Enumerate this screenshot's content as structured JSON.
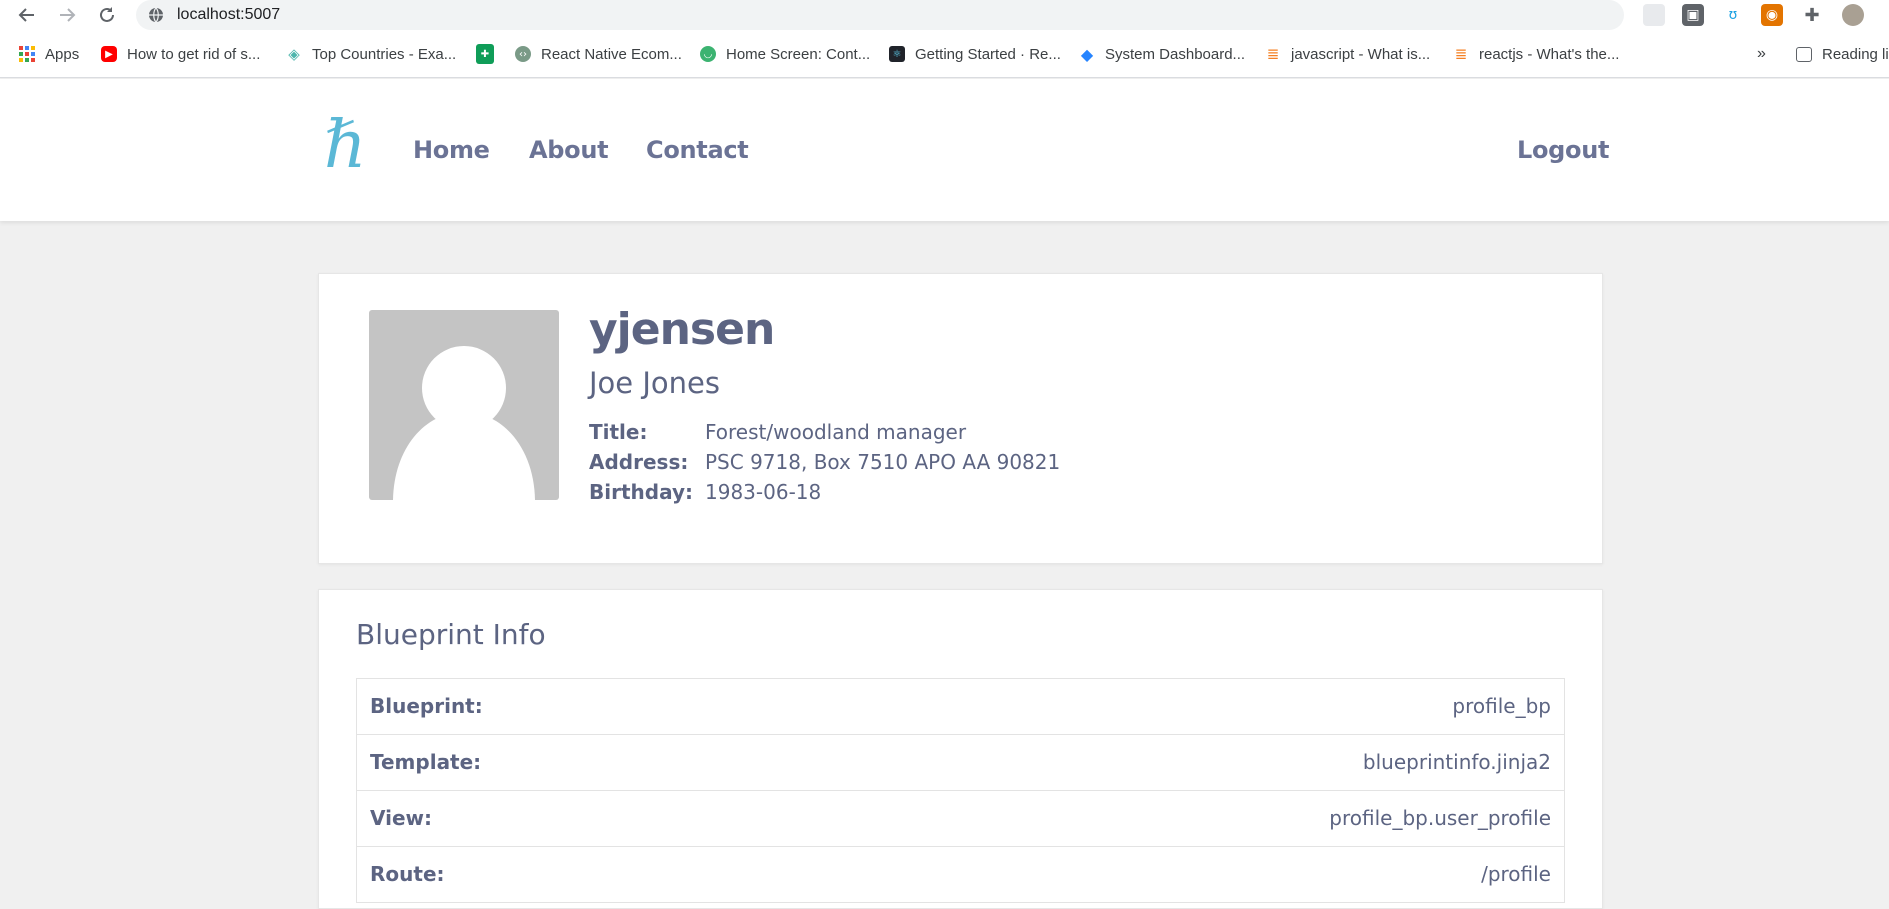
{
  "browser": {
    "url": "localhost:5007",
    "bookmarks": [
      {
        "label": "Apps",
        "icon": "apps-grid-icon"
      },
      {
        "label": "How to get rid of s...",
        "icon": "youtube-icon"
      },
      {
        "label": "Top Countries - Exa...",
        "icon": "layers-icon"
      },
      {
        "label": "",
        "icon": "sheets-icon"
      },
      {
        "label": "React Native Ecom...",
        "icon": "code-hex-icon"
      },
      {
        "label": "Home Screen: Cont...",
        "icon": "smile-icon"
      },
      {
        "label": "Getting Started · Re...",
        "icon": "react-icon"
      },
      {
        "label": "System Dashboard...",
        "icon": "jira-icon"
      },
      {
        "label": "javascript - What is...",
        "icon": "stackoverflow-icon"
      },
      {
        "label": "reactjs - What's the...",
        "icon": "stackoverflow-icon"
      }
    ],
    "more": "»",
    "reading_list": "Reading li"
  },
  "header": {
    "logo_glyph": "ℏ",
    "nav": [
      "Home",
      "About",
      "Contact"
    ],
    "logout": "Logout"
  },
  "profile": {
    "username": "yjensen",
    "name": "Joe Jones",
    "details": [
      {
        "label": "Title:",
        "value": "Forest/woodland manager"
      },
      {
        "label": "Address:",
        "value": "PSC 9718, Box 7510 APO AA 90821"
      },
      {
        "label": "Birthday:",
        "value": "1983-06-18"
      }
    ]
  },
  "blueprint": {
    "title": "Blueprint Info",
    "rows": [
      {
        "key": "Blueprint:",
        "value": "profile_bp"
      },
      {
        "key": "Template:",
        "value": "blueprintinfo.jinja2"
      },
      {
        "key": "View:",
        "value": "profile_bp.user_profile"
      },
      {
        "key": "Route:",
        "value": "/profile"
      }
    ]
  },
  "colors": {
    "text": "#5c6482",
    "nav": "#6b7395",
    "logo": "#5bb8d6",
    "avatar": "#c4c4c4"
  }
}
